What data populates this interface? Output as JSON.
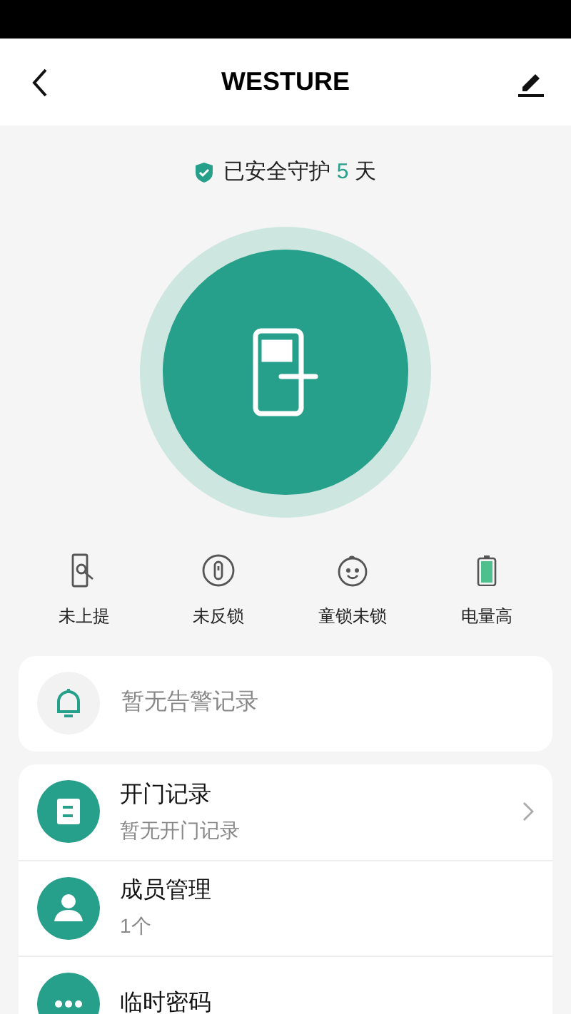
{
  "header": {
    "title": "WESTURE"
  },
  "protection": {
    "prefix": "已安全守护",
    "days": "5",
    "suffix": "天"
  },
  "statuses": [
    {
      "label": "未上提",
      "kind": "handle"
    },
    {
      "label": "未反锁",
      "kind": "deadbolt"
    },
    {
      "label": "童锁未锁",
      "kind": "childlock"
    },
    {
      "label": "电量高",
      "kind": "battery"
    }
  ],
  "alert": {
    "text": "暂无告警记录"
  },
  "menu": [
    {
      "title": "开门记录",
      "subtitle": "暂无开门记录",
      "kind": "records",
      "chevron": true
    },
    {
      "title": "成员管理",
      "subtitle": "1个",
      "kind": "members",
      "chevron": false
    },
    {
      "title": "临时密码",
      "kind": "password",
      "chevron": false
    }
  ]
}
